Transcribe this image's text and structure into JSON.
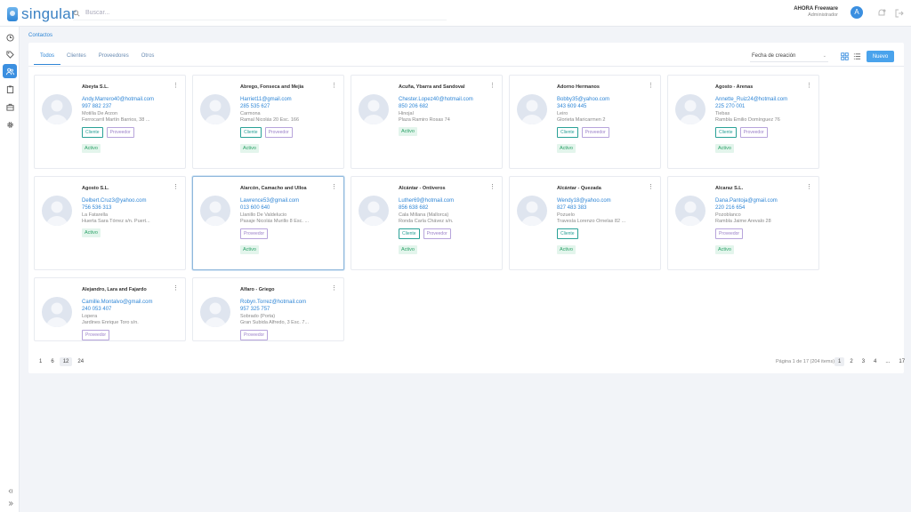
{
  "app": {
    "name": "singular"
  },
  "search": {
    "placeholder": "Buscar..."
  },
  "user": {
    "name": "AHORA Freeware",
    "role": "Administrador",
    "initial": "A"
  },
  "breadcrumb": "Contactos",
  "tabs": [
    {
      "label": "Todos",
      "active": true
    },
    {
      "label": "Clientes",
      "active": false
    },
    {
      "label": "Proveedores",
      "active": false
    },
    {
      "label": "Otros",
      "active": false
    }
  ],
  "sort": {
    "value": "Fecha de creación"
  },
  "new_button": "Nuevo",
  "contacts": [
    {
      "name": "Abeyta S.L.",
      "email": "Andy.Marrero40@hotmail.com",
      "phone": "997 882 237",
      "city": "Motilla De Arzon",
      "address": "Ferrocarril Martín Barrios, 38 ...",
      "tags": [
        "Cliente",
        "Proveedor"
      ],
      "status": "Activo"
    },
    {
      "name": "Abrego, Fonseca and Mejía",
      "email": "Harriet11@gmail.com",
      "phone": "285 535 627",
      "city": "Carmona",
      "address": "Ramal Nicolás 20 Esc. 166",
      "tags": [
        "Cliente",
        "Proveedor"
      ],
      "status": "Activo"
    },
    {
      "name": "Acuña, Ybarra and Sandoval",
      "email": "Chester.Lopez40@hotmail.com",
      "phone": "850 206 682",
      "city": "Hinojal",
      "address": "Plaza Ramiro Rosas 74",
      "tags": [],
      "status": "Activo"
    },
    {
      "name": "Adorno Hermanos",
      "email": "Bobby35@yahoo.com",
      "phone": "343 609 445",
      "city": "Leiro",
      "address": "Glorieta Maricarmen 2",
      "tags": [
        "Cliente",
        "Proveedor"
      ],
      "status": "Activo"
    },
    {
      "name": "Agosto - Arenas",
      "email": "Annette_Ruiz24@hotmail.com",
      "phone": "225 270 001",
      "city": "Tiebas",
      "address": "Rambla Emilio Domínguez 76",
      "tags": [
        "Cliente",
        "Proveedor"
      ],
      "status": "Activo"
    },
    {
      "name": "Agosto S.L.",
      "email": "Delbert.Cruz3@yahoo.com",
      "phone": "756 536 313",
      "city": "La Fatarella",
      "address": "Huerta Sara Tórrez s/n. Puert...",
      "tags": [],
      "status": "Activo"
    },
    {
      "name": "Alarcón, Camacho and Ulloa",
      "email": "Lawrence53@gmail.com",
      "phone": "013 600 640",
      "city": "Llanillo De Valdelucio",
      "address": "Pasaje Nicolás Murillo 8 Esc. ...",
      "tags": [
        "Proveedor"
      ],
      "status": "Activo"
    },
    {
      "name": "Alcántar - Ontiveros",
      "email": "Luther69@hotmail.com",
      "phone": "856 638 682",
      "city": "Cala Millana (Mallorca)",
      "address": "Ronda Carla Chávez s/n.",
      "tags": [
        "Cliente",
        "Proveedor"
      ],
      "status": "Activo"
    },
    {
      "name": "Alcántar - Quezada",
      "email": "Wendy18@yahoo.com",
      "phone": "827 483 383",
      "city": "Pozuelo",
      "address": "Travesía Lorenzo Ornelas 82 ...",
      "tags": [
        "Cliente"
      ],
      "status": "Activo"
    },
    {
      "name": "Alcaraz S.L.",
      "email": "Dana.Pantoja@gmail.com",
      "phone": "220 216 654",
      "city": "Pozoblanco",
      "address": "Rambla Jaime Arevalo 28",
      "tags": [
        "Proveedor"
      ],
      "status": "Activo"
    },
    {
      "name": "Alejandro, Lara and Fajardo",
      "email": "Camille.Montalvo@gmail.com",
      "phone": "240 053 407",
      "city": "Lopera",
      "address": "Jardines Enrique Toro s/n.",
      "tags": [
        "Proveedor"
      ],
      "status": ""
    },
    {
      "name": "Alfaro - Griego",
      "email": "Robyn.Torrez@hotmail.com",
      "phone": "957 325 757",
      "city": "Sobrado (Porta)",
      "address": "Gran Subida Alfredo, 3 Esc. 7...",
      "tags": [
        "Proveedor"
      ],
      "status": ""
    }
  ],
  "page_size_options": [
    {
      "label": "1",
      "active": false
    },
    {
      "label": "6",
      "active": false
    },
    {
      "label": "12",
      "active": true
    },
    {
      "label": "24",
      "active": false
    }
  ],
  "pagination": {
    "info": "Página 1 de 17 (204 items)",
    "pages": [
      {
        "label": "1",
        "active": true
      },
      {
        "label": "2",
        "active": false
      },
      {
        "label": "3",
        "active": false
      },
      {
        "label": "4",
        "active": false
      },
      {
        "label": "...",
        "active": false
      },
      {
        "label": "17",
        "active": false
      }
    ]
  }
}
